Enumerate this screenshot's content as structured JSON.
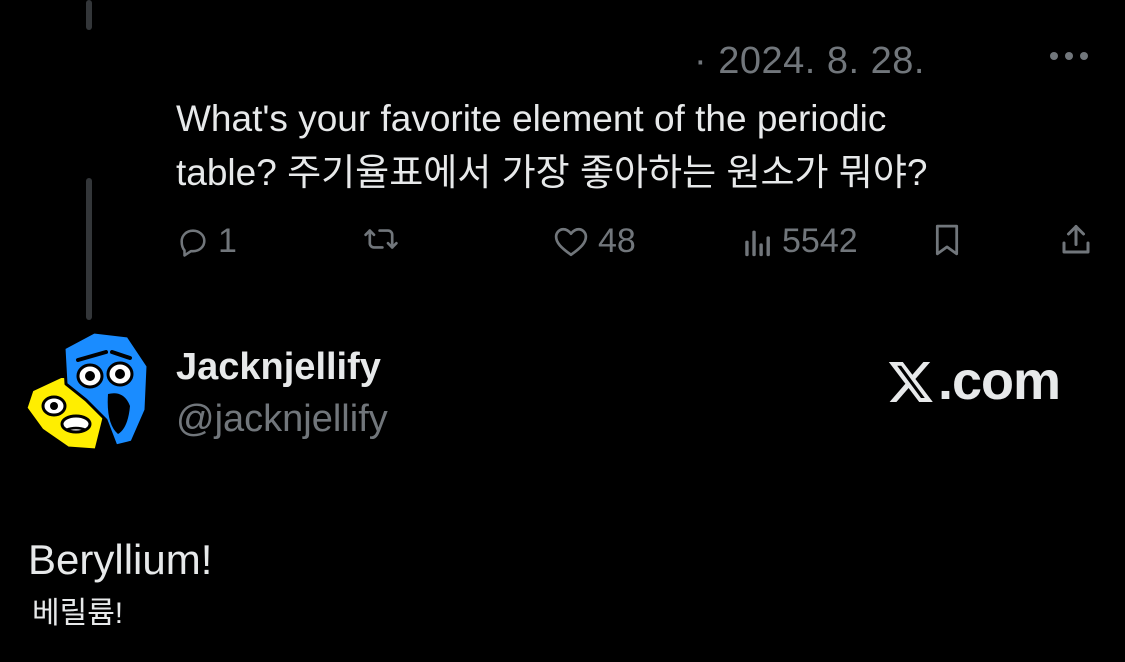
{
  "tweet": {
    "date": "· 2024. 8. 28.",
    "text_line1": "What's your favorite element of the periodic",
    "text_line2": "table? 주기율표에서 가장 좋아하는 원소가 뭐야?",
    "more_icon": "more-horizontal-icon"
  },
  "actions": {
    "reply_count": "1",
    "retweet_count": "",
    "like_count": "48",
    "view_count": "5542"
  },
  "reply": {
    "display_name": "Jacknjellify",
    "handle": "@jacknjellify",
    "brand_text": ".com",
    "text_en": "Beryllium!",
    "text_ko": "베릴륨!"
  },
  "colors": {
    "background": "#000000",
    "text": "#e7e9ea",
    "muted": "#71767b",
    "avatar_blue": "#1a8cff",
    "avatar_yellow": "#ffee00"
  }
}
